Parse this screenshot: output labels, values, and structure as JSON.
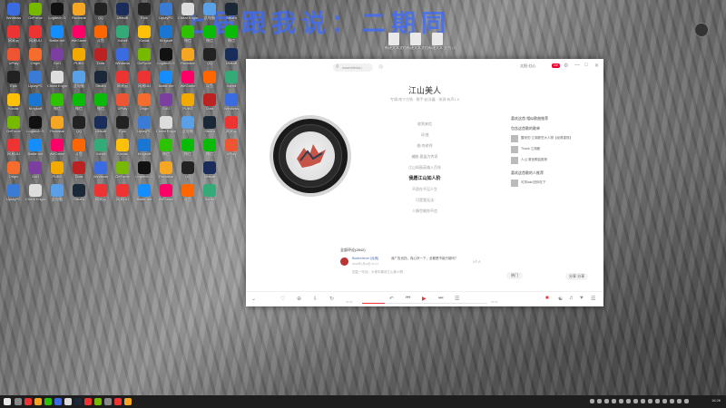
{
  "watermark": "上届跟我说：二期同",
  "desktop": {
    "left_icons": [
      {
        "label": "Windows",
        "color": "#3b6be0"
      },
      {
        "label": "GeForce",
        "color": "#76b900"
      },
      {
        "label": "Logitech G",
        "color": "#111"
      },
      {
        "label": "Rockstar",
        "color": "#f5a623"
      },
      {
        "label": "QQ",
        "color": "#222"
      },
      {
        "label": "Ubisoft",
        "color": "#1a2c5a"
      },
      {
        "label": "Epic",
        "color": "#222"
      },
      {
        "label": "UplayPC",
        "color": "#3a7bd5"
      },
      {
        "label": "Cheat Engine",
        "color": "#ddd"
      },
      {
        "label": "此电脑",
        "color": "#5aa0e6"
      },
      {
        "label": "Steam",
        "color": "#1b2838"
      },
      {
        "label": "网易云",
        "color": "#e33"
      },
      {
        "label": "网易UU",
        "color": "#e33"
      },
      {
        "label": "Battle.net",
        "color": "#148eff"
      },
      {
        "label": "WeGame",
        "color": "#f06"
      },
      {
        "label": "斗鱼",
        "color": "#f60"
      },
      {
        "label": "Xshell",
        "color": "#3a7"
      },
      {
        "label": "Kodak",
        "color": "#ffc107"
      },
      {
        "label": "Kingsoft",
        "color": "#1976d2"
      },
      {
        "label": "微信",
        "color": "#2dc100"
      },
      {
        "label": "微信",
        "color": "#09bb07"
      },
      {
        "label": "微信",
        "color": "#09bb07"
      },
      {
        "label": "UPlay",
        "color": "#e53"
      },
      {
        "label": "Origin",
        "color": "#f56c2d"
      },
      {
        "label": "GoG",
        "color": "#7b3fa0"
      },
      {
        "label": "PUBG",
        "color": "#f2a900"
      },
      {
        "label": "Dota",
        "color": "#b22"
      }
    ],
    "right_icons": [
      {
        "label": "新建文本文档"
      },
      {
        "label": "新建文本文档"
      },
      {
        "label": "新建文本 文档 (2)"
      }
    ]
  },
  "app": {
    "search_placeholder": "iuashbfhdsu",
    "user_label": "太阳·红心",
    "vip_label": "VIP",
    "song": {
      "title": "江山美人",
      "meta": "专辑:南宁古装 · 歌手:赵泳鑫 · 来源:有声1.5"
    },
    "lyrics": [
      {
        "text": "收到来信",
        "active": false
      },
      {
        "text": "词:烛",
        "active": false
      },
      {
        "text": "曲:何老师",
        "active": false
      },
      {
        "text": "编曲:夏晶为传奇",
        "active": false
      },
      {
        "text": "江山如画英雄入百年",
        "active": false
      },
      {
        "text": "我愿江山如人阶",
        "active": true
      },
      {
        "text": "不愿在不见人生",
        "active": false
      },
      {
        "text": "可是我无法",
        "active": false
      },
      {
        "text": "人情世故你不信",
        "active": false
      }
    ],
    "similar": {
      "heading": "喜欢这首 相似歌曲推荐",
      "sub1": "包含这首歌的歌单",
      "items": [
        {
          "text": "醒来的 江湖那些大人物【经典重现】"
        },
        {
          "text": "Thank 江湖都"
        },
        {
          "text": "人山 原创歌曲推荐"
        }
      ],
      "sub2": "喜欢这首歌的人推荐",
      "items2": [
        {
          "text": "可风lala 回你在下"
        }
      ]
    },
    "comments": {
      "header": "全部评论(2842)",
      "items": [
        {
          "user": "Bladeshevm",
          "tag": "经典",
          "text": "我广告也挡，真心好一下，全都是不能只能吗？",
          "time": "2020年1月18日 21:47",
          "likes": "1个人",
          "avatar": "#b33"
        },
        {
          "user": "",
          "tag": "",
          "text": "",
          "time": "",
          "likes": "",
          "avatar": "#ccc"
        }
      ],
      "reply_placeholder": "回复一写话：大佬你喜欢江山美人啊"
    },
    "buttons": {
      "tag": "热门",
      "share": "分享 分享"
    },
    "player": {
      "time_current": "00:32",
      "time_total": "03:30",
      "progress": 0.18
    }
  },
  "taskbar": {
    "clock": "16:26"
  }
}
